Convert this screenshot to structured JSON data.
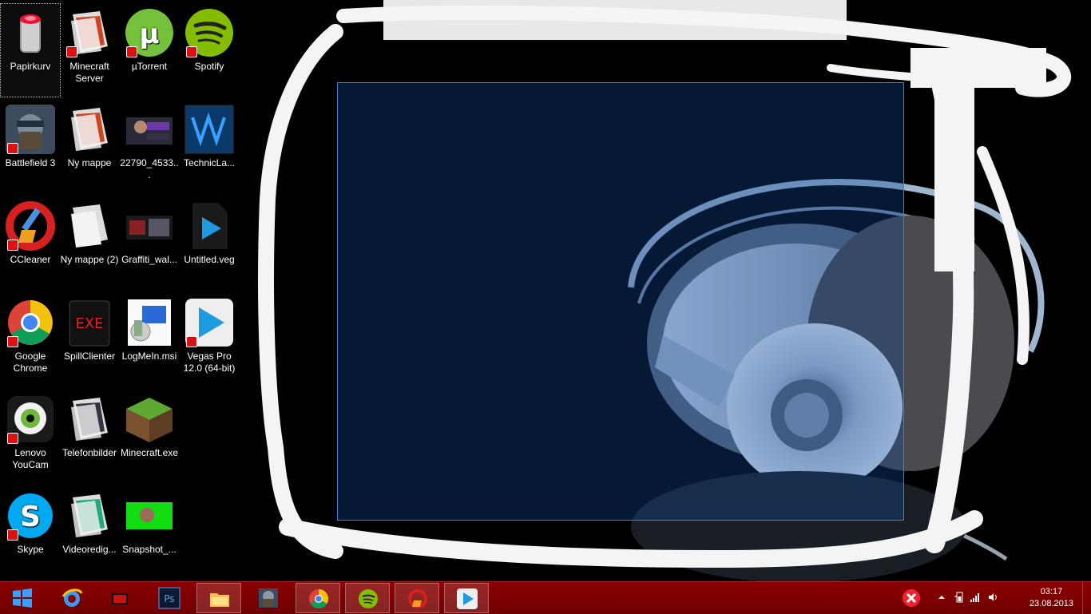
{
  "desktop": {
    "icons": [
      {
        "label": "Papirkurv",
        "icon": "recycle-bin-icon"
      },
      {
        "label": "Minecraft Server",
        "icon": "folder-icon"
      },
      {
        "label": "µTorrent",
        "icon": "utorrent-icon"
      },
      {
        "label": "Spotify",
        "icon": "spotify-icon"
      },
      {
        "label": "Battlefield 3",
        "icon": "battlefield-icon"
      },
      {
        "label": "Ny mappe",
        "icon": "folder-icon"
      },
      {
        "label": "22790_4533...",
        "icon": "image-thumbnail-icon"
      },
      {
        "label": "TechnicLa...",
        "icon": "technic-launcher-icon"
      },
      {
        "label": "CCleaner",
        "icon": "ccleaner-icon"
      },
      {
        "label": "Ny mappe (2)",
        "icon": "folder-icon"
      },
      {
        "label": "Graffiti_wal...",
        "icon": "image-thumbnail-icon"
      },
      {
        "label": "Untitled.veg",
        "icon": "vegas-file-icon"
      },
      {
        "label": "Google Chrome",
        "icon": "chrome-icon"
      },
      {
        "label": "SpillClienter",
        "icon": "exe-icon"
      },
      {
        "label": "LogMeIn.msi",
        "icon": "installer-icon"
      },
      {
        "label": "Vegas Pro 12.0 (64-bit)",
        "icon": "vegas-icon"
      },
      {
        "label": "Lenovo YouCam",
        "icon": "webcam-icon"
      },
      {
        "label": "Telefonbilder",
        "icon": "folder-icon"
      },
      {
        "label": "Minecraft.exe",
        "icon": "minecraft-icon"
      },
      {
        "label": "Skype",
        "icon": "skype-icon"
      },
      {
        "label": "Videoredig...",
        "icon": "folder-icon"
      },
      {
        "label": "Snapshot_...",
        "icon": "image-thumbnail-icon"
      }
    ]
  },
  "taskbar": {
    "pinned": [
      {
        "name": "start-button",
        "icon": "windows-logo-icon"
      },
      {
        "name": "internet-explorer",
        "icon": "ie-icon"
      },
      {
        "name": "app-red",
        "icon": "red-app-icon"
      },
      {
        "name": "photoshop",
        "icon": "photoshop-icon",
        "text": "Ps"
      },
      {
        "name": "file-explorer",
        "icon": "folder-icon"
      },
      {
        "name": "battlefield",
        "icon": "battlefield-icon"
      },
      {
        "name": "chrome",
        "icon": "chrome-icon"
      },
      {
        "name": "spotify",
        "icon": "spotify-icon"
      },
      {
        "name": "ccleaner",
        "icon": "ccleaner-icon"
      },
      {
        "name": "vegas",
        "icon": "vegas-icon"
      }
    ],
    "clock": {
      "time": "03:17",
      "date": "23.08.2013"
    }
  },
  "colors": {
    "taskbar": "#7d0000",
    "selection_border": "#3f83d6",
    "wallpaper_blue": "#0a2a55"
  }
}
